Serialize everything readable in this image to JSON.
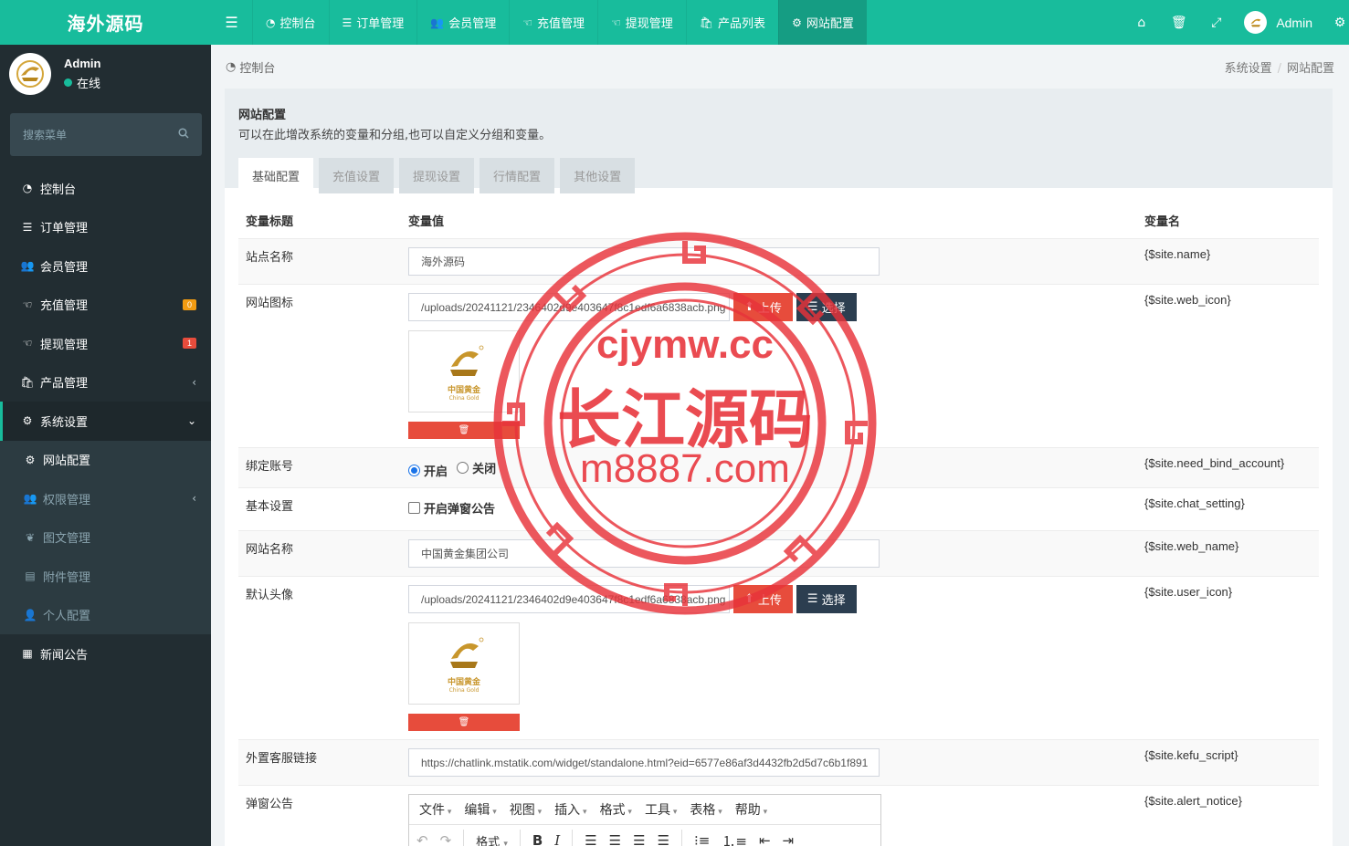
{
  "sidebar": {
    "logo": "海外源码",
    "user": {
      "name": "Admin",
      "status": "在线"
    },
    "search_placeholder": "搜索菜单",
    "items": [
      {
        "label": "控制台",
        "icon": "dashboard-icon"
      },
      {
        "label": "订单管理",
        "icon": "list-icon"
      },
      {
        "label": "会员管理",
        "icon": "users-icon"
      },
      {
        "label": "充值管理",
        "icon": "hand-icon",
        "badge": "0",
        "badge_color": "#f39c12"
      },
      {
        "label": "提现管理",
        "icon": "hand-icon",
        "badge": "1",
        "badge_color": "#e74c3c"
      },
      {
        "label": "产品管理",
        "icon": "bag-icon"
      },
      {
        "label": "系统设置",
        "icon": "cogs-icon"
      }
    ],
    "sub_items": [
      {
        "label": "网站配置",
        "icon": "gear-icon"
      },
      {
        "label": "权限管理",
        "icon": "group-icon"
      },
      {
        "label": "图文管理",
        "icon": "leaf-icon"
      },
      {
        "label": "附件管理",
        "icon": "file-image-icon"
      },
      {
        "label": "个人配置",
        "icon": "user-icon"
      }
    ],
    "news": {
      "label": "新闻公告",
      "icon": "newspaper-icon"
    }
  },
  "topnav": {
    "items": [
      {
        "label": "控制台",
        "icon": "dashboard-icon"
      },
      {
        "label": "订单管理",
        "icon": "list-icon"
      },
      {
        "label": "会员管理",
        "icon": "users-icon"
      },
      {
        "label": "充值管理",
        "icon": "hand-icon"
      },
      {
        "label": "提现管理",
        "icon": "hand-icon"
      },
      {
        "label": "产品列表",
        "icon": "bag-icon"
      },
      {
        "label": "网站配置",
        "icon": "gear-icon"
      }
    ],
    "user_name": "Admin"
  },
  "breadcrumb": {
    "current": "控制台",
    "path": [
      "系统设置",
      "网站配置"
    ]
  },
  "panel": {
    "title": "网站配置",
    "subtitle": "可以在此增改系统的变量和分组,也可以自定义分组和变量。",
    "tabs": [
      "基础配置",
      "充值设置",
      "提现设置",
      "行情配置",
      "其他设置"
    ]
  },
  "table": {
    "headers": [
      "变量标题",
      "变量值",
      "变量名"
    ],
    "site_name": {
      "title": "站点名称",
      "value": "海外源码",
      "var": "{$site.name}"
    },
    "web_icon": {
      "title": "网站图标",
      "value": "/uploads/20241121/2346402d9e403647f8c1edf6a6838acb.png",
      "var": "{$site.web_icon}"
    },
    "bind_account": {
      "title": "绑定账号",
      "on": "开启",
      "off": "关闭",
      "var": "{$site.need_bind_account}"
    },
    "chat_setting": {
      "title": "基本设置",
      "checkbox": "开启弹窗公告",
      "var": "{$site.chat_setting}"
    },
    "web_name": {
      "title": "网站名称",
      "value": "中国黄金集团公司",
      "var": "{$site.web_name}"
    },
    "user_icon": {
      "title": "默认头像",
      "value": "/uploads/20241121/2346402d9e403647f8c1edf6a6838acb.png",
      "var": "{$site.user_icon}"
    },
    "kefu": {
      "title": "外置客服链接",
      "value": "https://chatlink.mstatik.com/widget/standalone.html?eid=6577e86af3d4432fb2d5d7c6b1f891",
      "var": "{$site.kefu_script}"
    },
    "alert_notice": {
      "title": "弹窗公告",
      "var": "{$site.alert_notice}"
    }
  },
  "buttons": {
    "upload": "上传",
    "select": "选择"
  },
  "logo_text": {
    "cn": "中国黄金",
    "en": "China Gold"
  },
  "editor": {
    "menus": [
      "文件",
      "编辑",
      "视图",
      "插入",
      "格式",
      "工具",
      "表格",
      "帮助"
    ],
    "format_label": "格式"
  },
  "watermark": {
    "line1": "cjymw.cc",
    "line2": "长江源码",
    "line3": "m8887.com"
  }
}
